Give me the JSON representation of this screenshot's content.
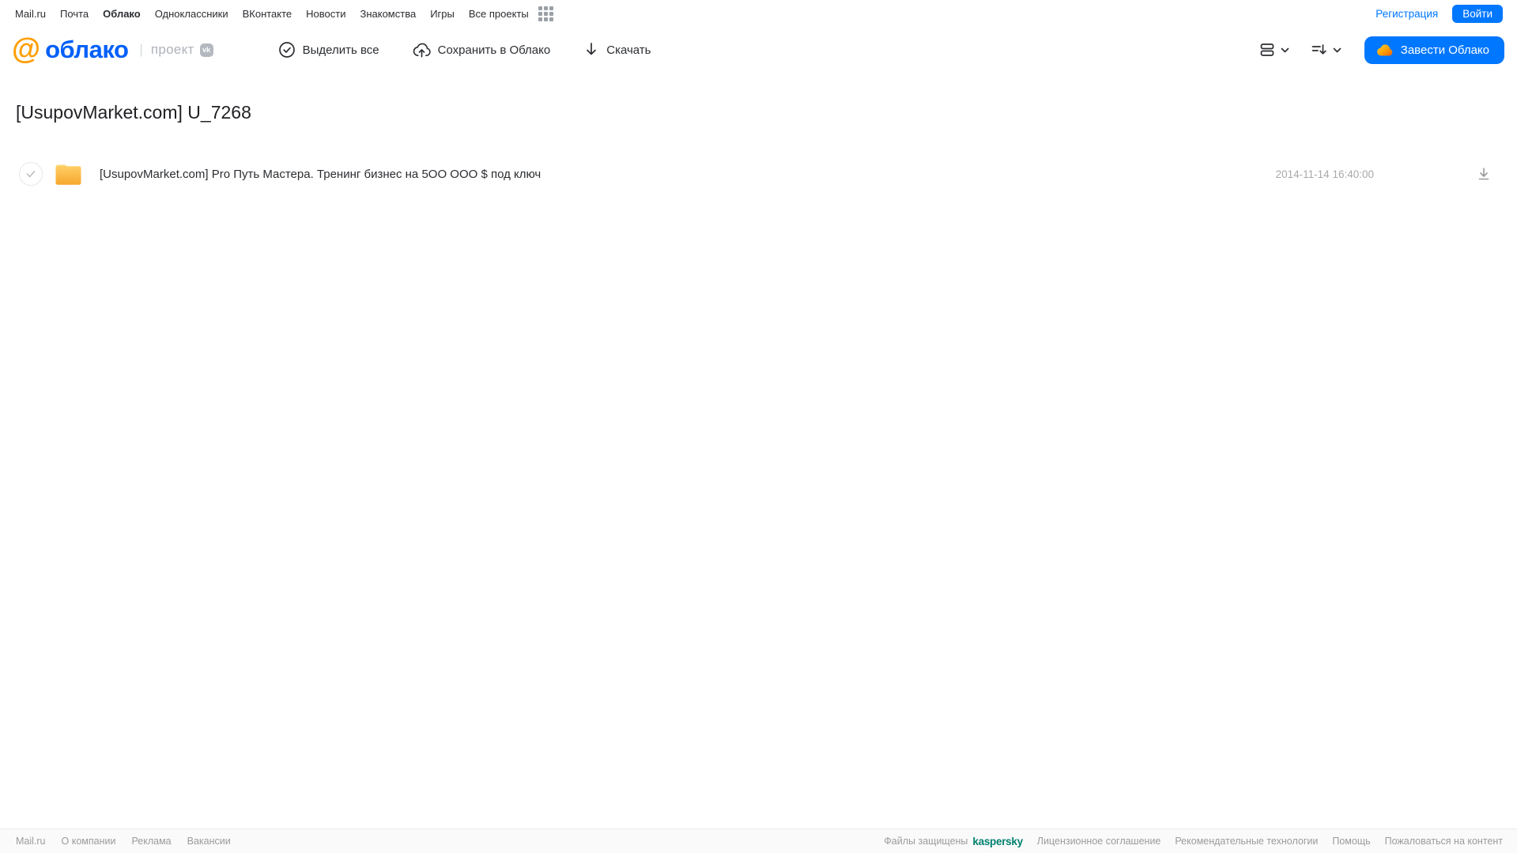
{
  "top_nav": {
    "items": [
      {
        "label": "Mail.ru"
      },
      {
        "label": "Почта"
      },
      {
        "label": "Облако"
      },
      {
        "label": "Одноклассники"
      },
      {
        "label": "ВКонтакте"
      },
      {
        "label": "Новости"
      },
      {
        "label": "Знакомства"
      },
      {
        "label": "Игры"
      },
      {
        "label": "Все проекты"
      }
    ],
    "register_label": "Регистрация",
    "login_label": "Войти"
  },
  "toolbar": {
    "logo_at": "@",
    "logo_text": "облако",
    "project_label": "проект",
    "vk_badge": "vk",
    "select_all_label": "Выделить все",
    "save_to_cloud_label": "Сохранить в Облако",
    "download_label": "Скачать",
    "cta_label": "Завести Облако"
  },
  "main": {
    "title": "[UsupovMarket.com] U_7268",
    "files": [
      {
        "type": "folder",
        "name": "[UsupovMarket.com] Pro Путь Мастера. Тренинг бизнес на 5ОО ООО $ под ключ",
        "date": "2014-11-14 16:40:00"
      }
    ]
  },
  "footer": {
    "left_links": [
      "Mail.ru",
      "О компании",
      "Реклама",
      "Вакансии"
    ],
    "protected_text": "Файлы защищены",
    "kaspersky_label": "kaspersky",
    "right_links": [
      "Лицензионное соглашение",
      "Рекомендательные технологии",
      "Помощь",
      "Пожаловаться на контент"
    ]
  },
  "colors": {
    "accent_blue": "#0077ff",
    "logo_blue": "#005ff9",
    "logo_orange": "#ff9e00",
    "folder_yellow": "#ffc04d",
    "kaspersky_green": "#00806e",
    "muted_gray": "#a9a9a9"
  }
}
